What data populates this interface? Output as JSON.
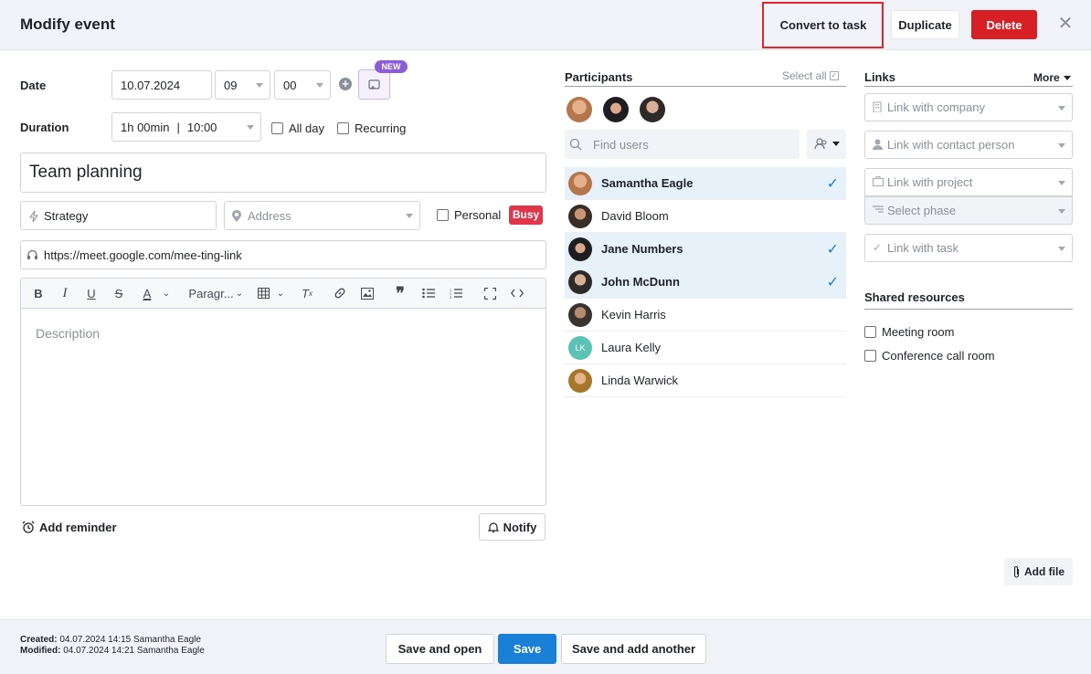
{
  "header": {
    "title": "Modify event",
    "convert_label": "Convert to task",
    "duplicate_label": "Duplicate",
    "delete_label": "Delete"
  },
  "form": {
    "date_label": "Date",
    "date_value": "10.07.2024",
    "hour_value": "09",
    "minute_value": "00",
    "new_badge": "NEW",
    "duration_label": "Duration",
    "duration_value": "1h 00min",
    "duration_time": "10:00",
    "allday_label": "All day",
    "recurring_label": "Recurring",
    "title_value": "Team planning",
    "category_value": "Strategy",
    "address_placeholder": "Address",
    "personal_label": "Personal",
    "busy_badge": "Busy",
    "meeting_link": "https://meet.google.com/mee-ting-link",
    "paragraph_label": "Paragr...",
    "description_placeholder": "Description",
    "add_reminder_label": "Add reminder",
    "notify_label": "Notify"
  },
  "participants": {
    "title": "Participants",
    "select_all_label": "Select all",
    "find_placeholder": "Find users",
    "list": [
      {
        "name": "Samantha Eagle",
        "selected": true
      },
      {
        "name": "David Bloom",
        "selected": false
      },
      {
        "name": "Jane Numbers",
        "selected": true
      },
      {
        "name": "John McDunn",
        "selected": true
      },
      {
        "name": "Kevin Harris",
        "selected": false
      },
      {
        "name": "Laura Kelly",
        "selected": false,
        "initials": "LK"
      },
      {
        "name": "Linda Warwick",
        "selected": false
      }
    ]
  },
  "links": {
    "title": "Links",
    "more_label": "More",
    "company": "Link with company",
    "contact": "Link with contact person",
    "project": "Link with project",
    "phase": "Select phase",
    "task": "Link with task"
  },
  "resources": {
    "title": "Shared resources",
    "items": [
      "Meeting room",
      "Conference call room"
    ]
  },
  "add_file_label": "Add file",
  "footer": {
    "created_label": "Created:",
    "created_value": "04.07.2024 14:15 Samantha Eagle",
    "modified_label": "Modified:",
    "modified_value": "04.07.2024 14:21 Samantha Eagle",
    "save_open_label": "Save and open",
    "save_label": "Save",
    "save_another_label": "Save and add another"
  },
  "colors": {
    "accent": "#1a7fd6",
    "delete": "#d71f26",
    "busy": "#e0354a",
    "new_badge": "#8b5cd6",
    "selected_row": "#e6f1fa"
  }
}
